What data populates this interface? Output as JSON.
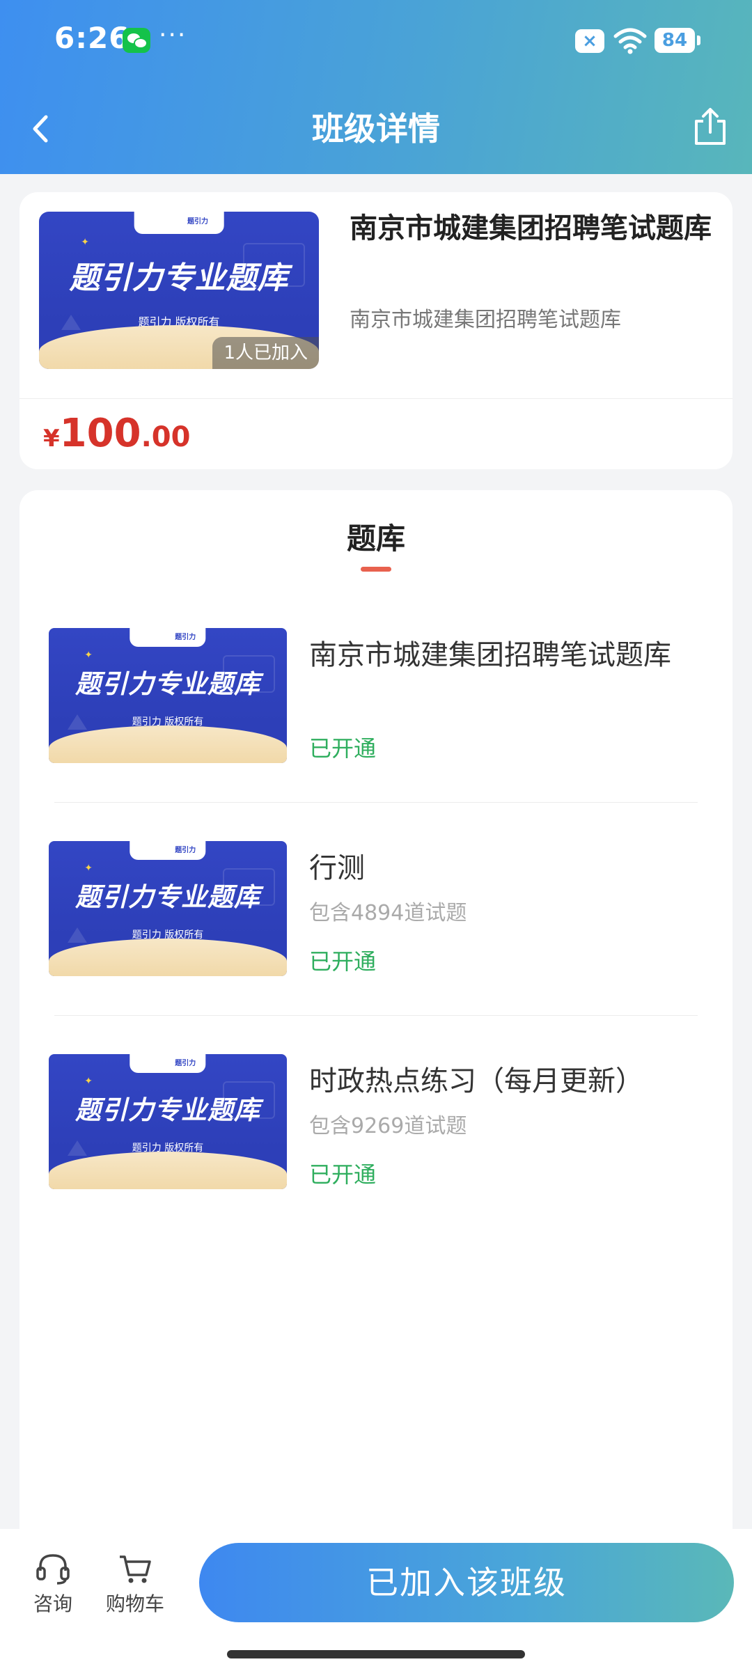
{
  "status_bar": {
    "time": "6:26",
    "dots": "···",
    "battery": "84"
  },
  "header": {
    "title": "班级详情"
  },
  "class_card": {
    "cover": {
      "logo": "题引力",
      "headline": "题引力专业题库",
      "sub": "题引力 版权所有"
    },
    "joined_badge": "1人已加入",
    "title": "南京市城建集团招聘笔试题库",
    "subtitle": "南京市城建集团招聘笔试题库",
    "price": {
      "yen": "¥",
      "int": "100",
      "dec": ".00"
    }
  },
  "bank_section": {
    "title": "题库",
    "items": [
      {
        "name": "南京市城建集团招聘笔试题库",
        "count": "",
        "status": "已开通"
      },
      {
        "name": "行测",
        "count": "包含4894道试题",
        "status": "已开通"
      },
      {
        "name": "时政热点练习（每月更新）",
        "count": "包含9269道试题",
        "status": "已开通"
      }
    ]
  },
  "bottom_bar": {
    "consult": "咨询",
    "cart": "购物车",
    "join_button": "已加入该班级"
  },
  "colors": {
    "price": "#d6332a",
    "status": "#2fae5e",
    "accent": "#e8614e",
    "header_start": "#3e8ff0",
    "header_end": "#58b6bb"
  }
}
